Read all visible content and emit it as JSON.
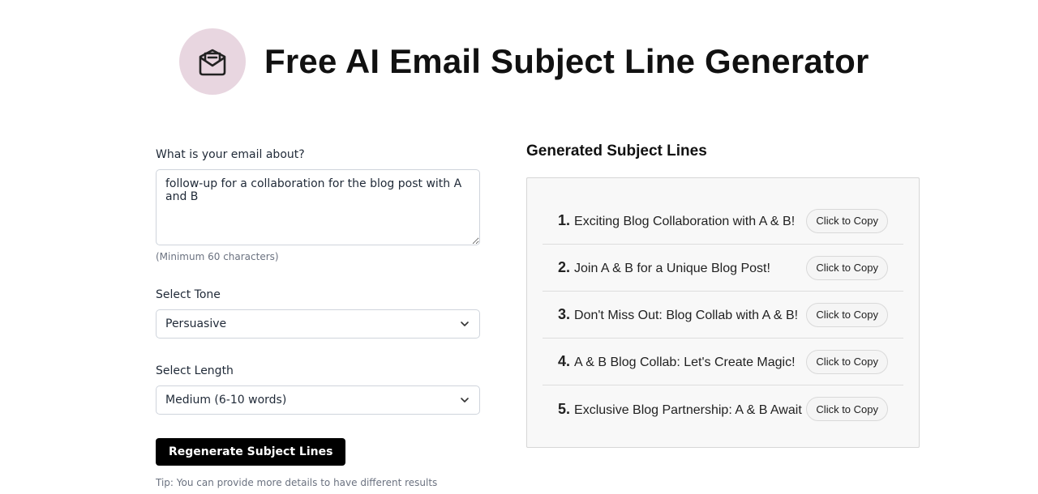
{
  "header": {
    "title": "Free AI Email Subject Line Generator",
    "logo_icon": "envelope-open-icon",
    "logo_bg": "#e8d6e0"
  },
  "form": {
    "email_label": "What is your email about?",
    "email_value": "follow-up for a collaboration for the blog post with A and B",
    "email_hint": "(Minimum 60 characters)",
    "tone_label": "Select Tone",
    "tone_value": "Persuasive",
    "length_label": "Select Length",
    "length_value": "Medium (6-10 words)",
    "regenerate_label": "Regenerate Subject Lines",
    "tip": "Tip: You can provide more details to have different results"
  },
  "results": {
    "title": "Generated Subject Lines",
    "items": [
      {
        "num": "1.",
        "text": "Exciting Blog Collaboration with A & B!",
        "copy_label": "Click to Copy"
      },
      {
        "num": "2.",
        "text": "Join A & B for a Unique Blog Post!",
        "copy_label": "Click to Copy"
      },
      {
        "num": "3.",
        "text": "Don't Miss Out: Blog Collab with A & B!",
        "copy_label": "Click to Copy"
      },
      {
        "num": "4.",
        "text": "A & B Blog Collab: Let's Create Magic!",
        "copy_label": "Click to Copy"
      },
      {
        "num": "5.",
        "text": "Exclusive Blog Partnership: A & B Await",
        "copy_label": "Click to Copy"
      }
    ]
  },
  "colors": {
    "primary_button": "#000000",
    "panel_bg": "#f8f8f8"
  }
}
